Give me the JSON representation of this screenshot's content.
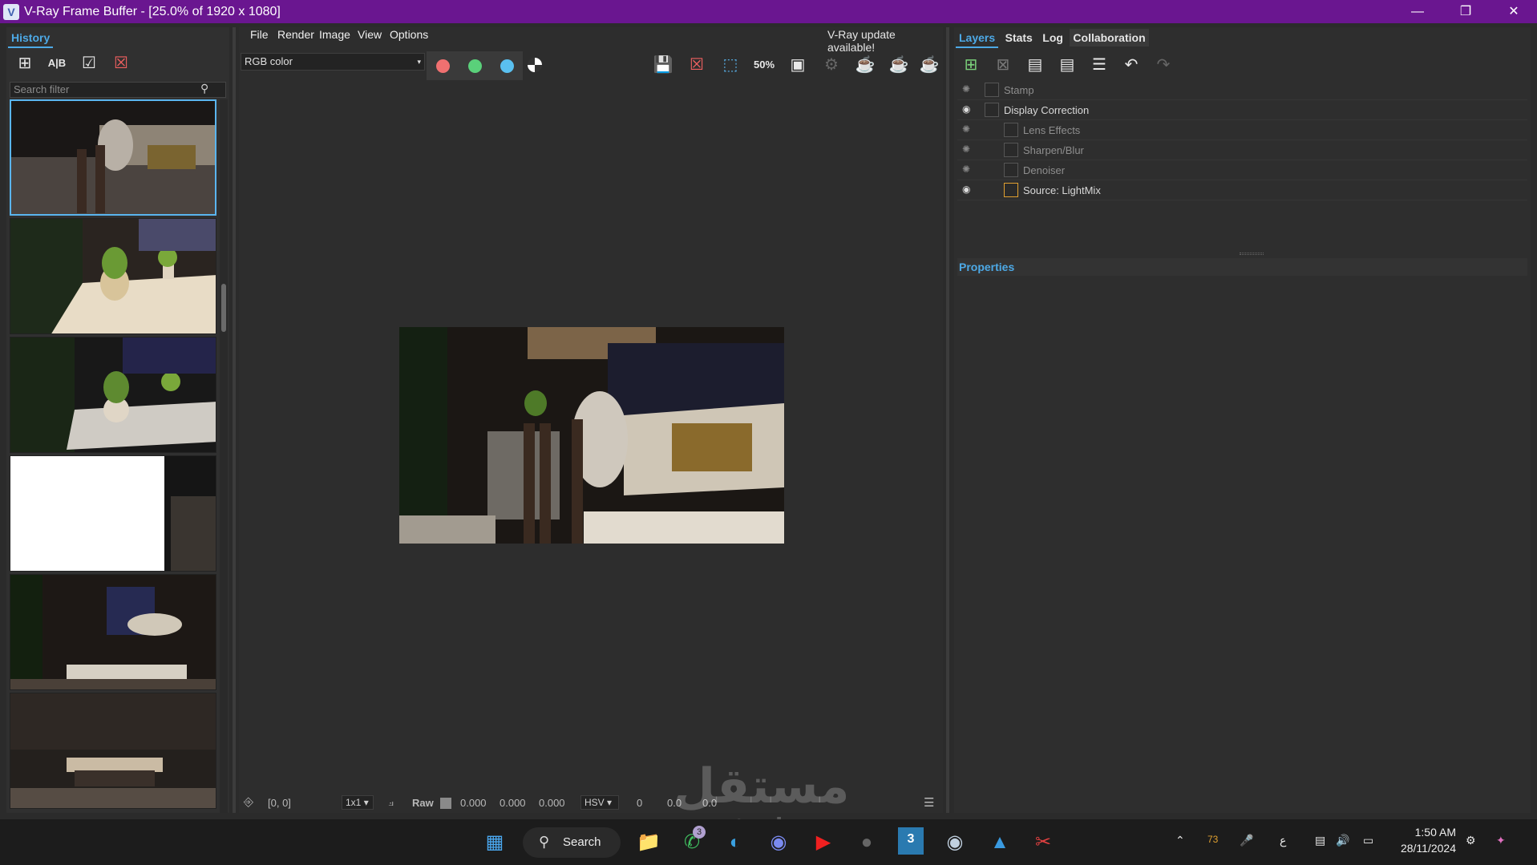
{
  "window": {
    "title": "V-Ray Frame Buffer - [25.0% of 1920 x 1080]",
    "logo": "V"
  },
  "history": {
    "tab": "History",
    "toolbar_icons": [
      "save-to-history-icon",
      "ab-compare-icon",
      "load-history-icon",
      "remove-history-icon"
    ],
    "search_placeholder": "Search filter"
  },
  "menu": {
    "items": [
      "File",
      "Render",
      "Image",
      "View",
      "Options"
    ],
    "update_notice": "V-Ray update available!"
  },
  "channel": {
    "selected": "RGB color"
  },
  "toolbar": {
    "zoom_label": "50%"
  },
  "statusbar": {
    "coords": "[0, 0]",
    "sample": "1x1",
    "raw_label": "Raw",
    "values": [
      "0.000",
      "0.000",
      "0.000"
    ],
    "color_mode": "HSV",
    "hsv_values": [
      "0",
      "0.0",
      "0.0"
    ]
  },
  "right_panel": {
    "tabs": [
      "Layers",
      "Stats",
      "Log",
      "Collaboration"
    ],
    "layers": [
      {
        "label": "Stamp",
        "visible": false,
        "indent": 0
      },
      {
        "label": "Display Correction",
        "visible": true,
        "indent": 0
      },
      {
        "label": "Lens Effects",
        "visible": false,
        "indent": 1
      },
      {
        "label": "Sharpen/Blur",
        "visible": false,
        "indent": 1
      },
      {
        "label": "Denoiser",
        "visible": false,
        "indent": 1
      },
      {
        "label": "Source: LightMix",
        "visible": true,
        "indent": 1
      }
    ],
    "properties_label": "Properties"
  },
  "taskbar": {
    "search_label": "Search",
    "whatsapp_badge": "3",
    "max_badge": "3",
    "temperature": "73",
    "lang": "ع",
    "time": "1:50 AM",
    "date": "28/11/2024"
  },
  "watermark": {
    "arabic": "مستقل",
    "latin": "mostaql.com"
  },
  "colors": {
    "titlebar": "#6a1690",
    "accent": "#4da9e6",
    "red": "#f07070",
    "green": "#5ad07a",
    "blue": "#5ac0f0"
  }
}
